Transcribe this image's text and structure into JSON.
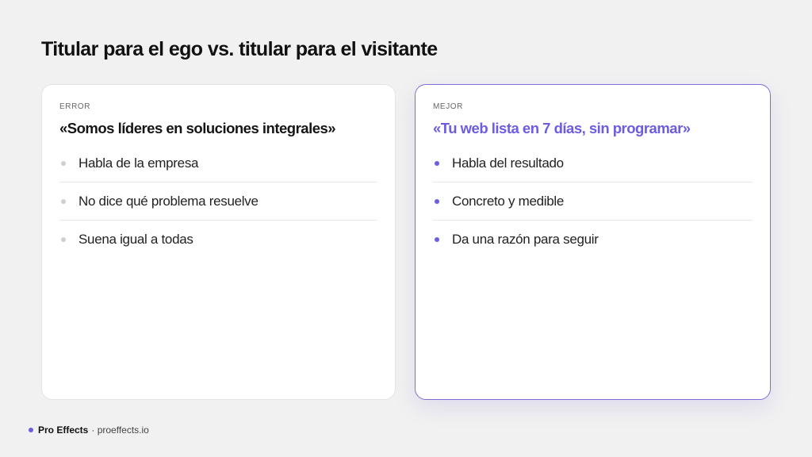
{
  "slide": {
    "title": "Titular para el ego vs. titular para el visitante"
  },
  "cards": {
    "error": {
      "label": "ERROR",
      "headline": "«Somos líderes en soluciones integrales»",
      "points": [
        "Habla de la empresa",
        "No dice qué problema resuelve",
        "Suena igual a todas"
      ]
    },
    "better": {
      "label": "MEJOR",
      "headline": "«Tu web lista en 7 días, sin programar»",
      "points": [
        "Habla del resultado",
        "Concreto y medible",
        "Da una razón para seguir"
      ]
    }
  },
  "footer": {
    "brand": "Pro Effects",
    "site": "· proeffects.io"
  },
  "colors": {
    "accent": "#6c5ce0",
    "background": "#f1f1f1",
    "card": "#ffffff"
  }
}
